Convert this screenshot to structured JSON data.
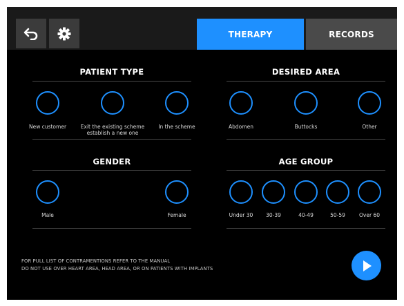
{
  "header": {
    "back_icon": "back-arrow-icon",
    "settings_icon": "gear-icon",
    "tabs": [
      {
        "label": "THERAPY",
        "active": true
      },
      {
        "label": "RECORDS",
        "active": false
      }
    ]
  },
  "patient_type": {
    "title": "PATIENT TYPE",
    "options": [
      {
        "label": "New customer"
      },
      {
        "label": "Exit the existing scheme",
        "label2": "establish a new one"
      },
      {
        "label": "In the scheme"
      }
    ]
  },
  "desired_area": {
    "title": "DESIRED AREA",
    "options": [
      {
        "label": "Abdomen"
      },
      {
        "label": "Buttocks"
      },
      {
        "label": "Other"
      }
    ]
  },
  "gender": {
    "title": "GENDER",
    "options": [
      {
        "label": "Male"
      },
      {
        "label": "Female"
      }
    ]
  },
  "age_group": {
    "title": "AGE GROUP",
    "options": [
      {
        "label": "Under 30"
      },
      {
        "label": "30-39"
      },
      {
        "label": "40-49"
      },
      {
        "label": "50-59"
      },
      {
        "label": "Over 60"
      }
    ]
  },
  "warnings": {
    "line1": "FOR PULL LIST OF CONTRAMENTIONS REFER TO THE MANUAL",
    "line2": "DO NOT USE OVER HEART AREA, HEAD AREA, OR ON PATIENTS WITH IMPLANTS"
  },
  "play_icon": "play-icon",
  "colors": {
    "accent": "#1e90ff",
    "background": "#000000",
    "tab_inactive": "#4a4a4a"
  }
}
